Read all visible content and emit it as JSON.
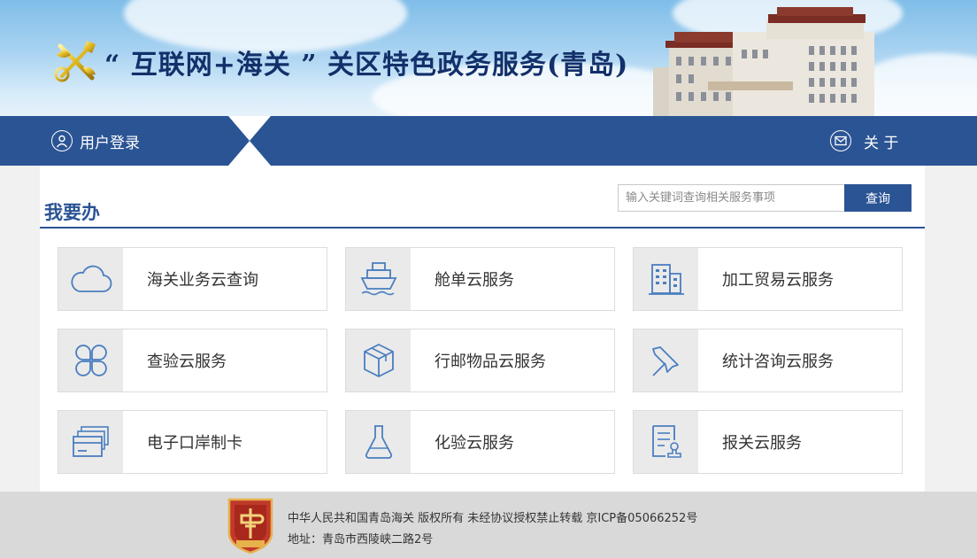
{
  "header": {
    "title": "“ 互联网+海关 ” 关区特色政务服务(青岛)",
    "emblem_icon": "customs-emblem-icon",
    "building_image": "customs-building-image"
  },
  "nav": {
    "login_label": "用户登录",
    "login_icon": "user-icon",
    "about_label": "关 于",
    "about_icon": "mail-icon",
    "bar_color": "#2b5494"
  },
  "main": {
    "section_title": "我要办",
    "search": {
      "placeholder": "输入关键词查询相关服务事项",
      "value": "",
      "button_label": "查询"
    },
    "services": [
      {
        "label": "海关业务云查询",
        "icon": "cloud-icon"
      },
      {
        "label": "舱单云服务",
        "icon": "ship-icon"
      },
      {
        "label": "加工贸易云服务",
        "icon": "buildings-icon"
      },
      {
        "label": "查验云服务",
        "icon": "clover-icon"
      },
      {
        "label": "行邮物品云服务",
        "icon": "package-icon"
      },
      {
        "label": "统计咨询云服务",
        "icon": "pin-icon"
      },
      {
        "label": "电子口岸制卡",
        "icon": "cards-icon"
      },
      {
        "label": "化验云服务",
        "icon": "flask-icon"
      },
      {
        "label": "报关云服务",
        "icon": "document-stamp-icon"
      }
    ]
  },
  "footer": {
    "badge_icon": "party-government-badge-icon",
    "line1": "中华人民共和国青岛海关 版权所有 未经协议授权禁止转载 京ICP备05066252号",
    "line2": "地址：青岛市西陵峡二路2号"
  },
  "colors": {
    "primary": "#2b5494",
    "icon_blue": "#4a7ec0",
    "title_blue": "#13306a",
    "badge_red": "#c0392b"
  }
}
